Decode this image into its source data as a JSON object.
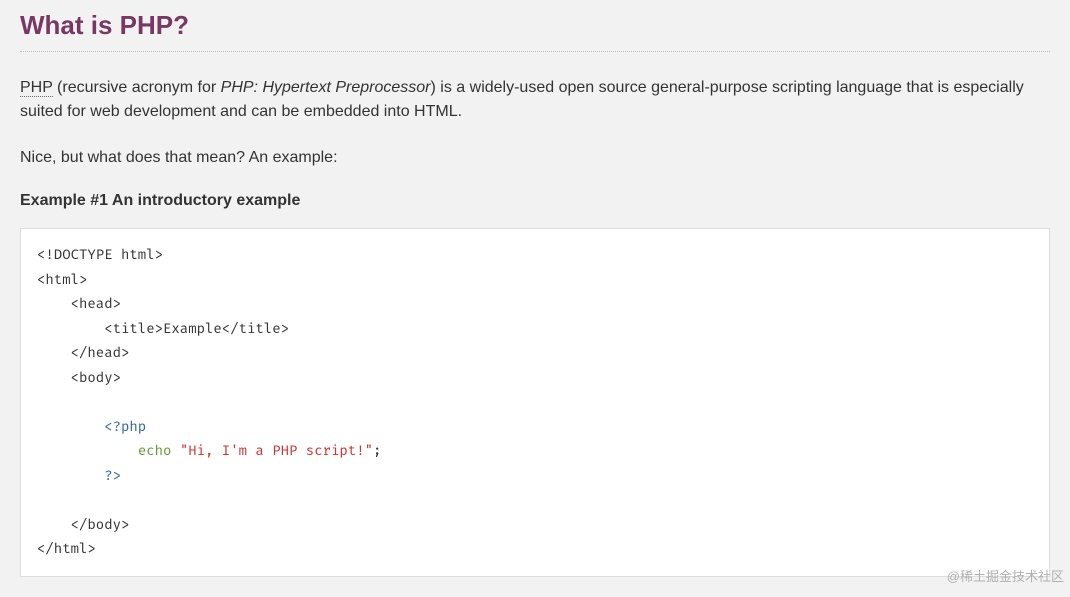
{
  "heading": "What is PHP?",
  "para1": {
    "abbr": "PHP",
    "before_italic": " (recursive acronym for ",
    "italic": "PHP: Hypertext Preprocessor",
    "after_italic": ") is a widely-used open source general-purpose scripting language that is especially suited for web development and can be embedded into HTML."
  },
  "para2": "Nice, but what does that mean? An example:",
  "example_title": "Example #1 An introductory example",
  "code": {
    "l1": "<!DOCTYPE html>",
    "l2": "<html>",
    "l3": "    <head>",
    "l4": "        <title>Example</title>",
    "l5": "    </head>",
    "l6": "    <body>",
    "l7": "",
    "l8a": "        ",
    "l8b": "<?php",
    "l9a": "            ",
    "l9b": "echo ",
    "l9c": "\"Hi, I'm a PHP script!\"",
    "l9d": ";",
    "l10a": "        ",
    "l10b": "?>",
    "l11": "",
    "l12": "    </body>",
    "l13": "</html>"
  },
  "watermark": "@稀土掘金技术社区"
}
